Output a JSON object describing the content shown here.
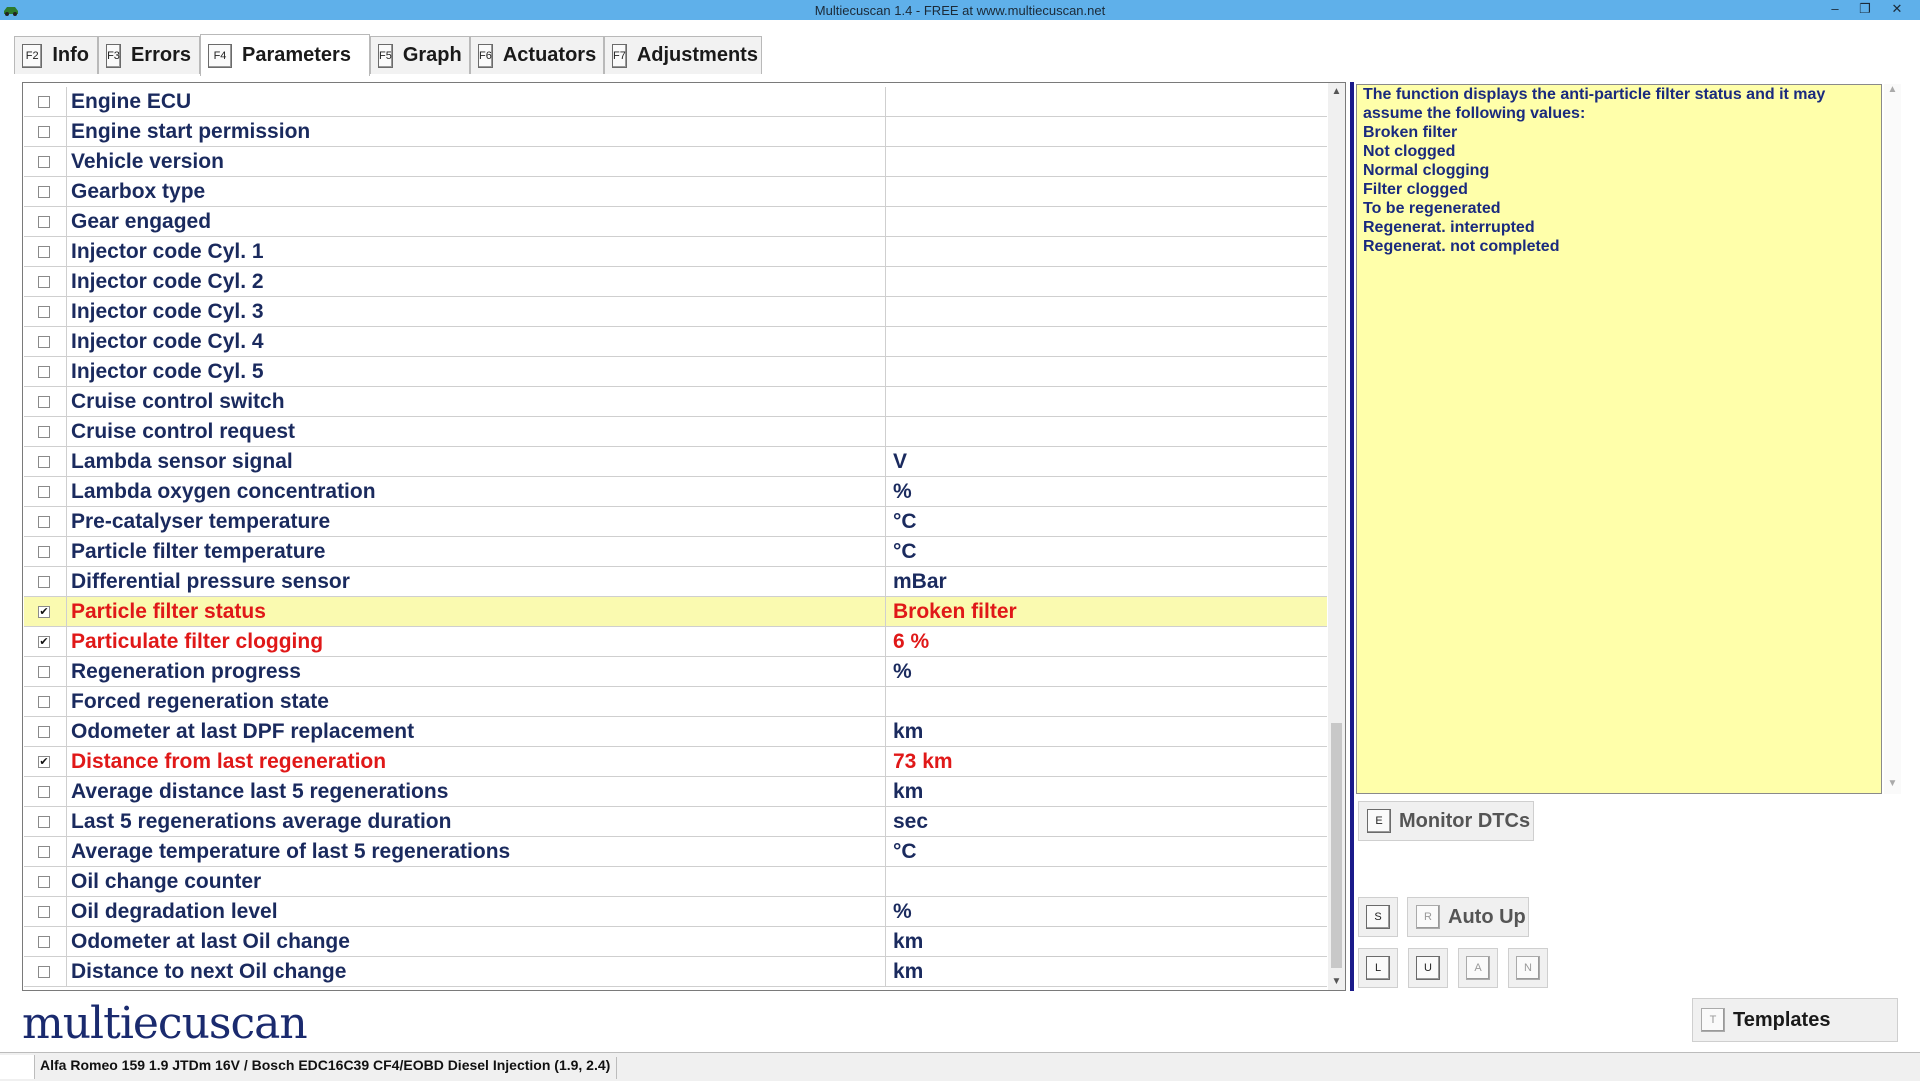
{
  "window": {
    "title": "Multiecuscan 1.4 - FREE at www.multiecuscan.net",
    "minimize": "–",
    "restore": "❐",
    "close": "✕"
  },
  "tabs": [
    {
      "key": "F2",
      "label": "Info",
      "active": false
    },
    {
      "key": "F3",
      "label": "Errors",
      "active": false
    },
    {
      "key": "F4",
      "label": "Parameters",
      "active": true
    },
    {
      "key": "F5",
      "label": "Graph",
      "active": false
    },
    {
      "key": "F6",
      "label": "Actuators",
      "active": false
    },
    {
      "key": "F7",
      "label": "Adjustments",
      "active": false
    }
  ],
  "parameters": [
    {
      "name": "Engine ECU",
      "value": "",
      "checked": false
    },
    {
      "name": "Engine start permission",
      "value": "",
      "checked": false
    },
    {
      "name": "Vehicle version",
      "value": "",
      "checked": false
    },
    {
      "name": "Gearbox type",
      "value": "",
      "checked": false
    },
    {
      "name": "Gear engaged",
      "value": "",
      "checked": false
    },
    {
      "name": "Injector code Cyl. 1",
      "value": "",
      "checked": false
    },
    {
      "name": "Injector code Cyl. 2",
      "value": "",
      "checked": false
    },
    {
      "name": "Injector code Cyl. 3",
      "value": "",
      "checked": false
    },
    {
      "name": "Injector code Cyl. 4",
      "value": "",
      "checked": false
    },
    {
      "name": "Injector code Cyl. 5",
      "value": "",
      "checked": false
    },
    {
      "name": "Cruise control switch",
      "value": "",
      "checked": false
    },
    {
      "name": "Cruise control request",
      "value": "",
      "checked": false
    },
    {
      "name": "Lambda sensor signal",
      "value": "V",
      "checked": false
    },
    {
      "name": "Lambda oxygen concentration",
      "value": "%",
      "checked": false
    },
    {
      "name": "Pre-catalyser temperature",
      "value": "°C",
      "checked": false
    },
    {
      "name": "Particle filter temperature",
      "value": "°C",
      "checked": false
    },
    {
      "name": "Differential pressure sensor",
      "value": "mBar",
      "checked": false
    },
    {
      "name": "Particle filter status",
      "value": "Broken filter",
      "checked": true,
      "selected": true
    },
    {
      "name": "Particulate filter clogging",
      "value": "6 %",
      "checked": true
    },
    {
      "name": "Regeneration progress",
      "value": "%",
      "checked": false
    },
    {
      "name": "Forced regeneration state",
      "value": "",
      "checked": false
    },
    {
      "name": "Odometer at last DPF replacement",
      "value": "km",
      "checked": false
    },
    {
      "name": "Distance from last regeneration",
      "value": "73 km",
      "checked": true
    },
    {
      "name": "Average distance last 5 regenerations",
      "value": "km",
      "checked": false
    },
    {
      "name": "Last 5 regenerations average duration",
      "value": "sec",
      "checked": false
    },
    {
      "name": "Average temperature of last 5 regenerations",
      "value": "°C",
      "checked": false
    },
    {
      "name": "Oil change counter",
      "value": "",
      "checked": false
    },
    {
      "name": "Oil degradation level",
      "value": "%",
      "checked": false
    },
    {
      "name": "Odometer at last Oil change",
      "value": "km",
      "checked": false
    },
    {
      "name": "Distance to next Oil change",
      "value": "km",
      "checked": false
    }
  ],
  "description": {
    "lines": [
      "The function displays the anti-particle filter status and it may",
      "assume the following values:",
      "Broken filter",
      "Not clogged",
      "Normal clogging",
      "Filter clogged",
      "To be regenerated",
      "Regenerat. interrupted",
      "Regenerat. not completed"
    ]
  },
  "buttons": {
    "monitor_dtcs": {
      "key": "E",
      "label": "Monitor DTCs"
    },
    "s": {
      "key": "S"
    },
    "auto_up": {
      "key": "R",
      "label": "Auto Up"
    },
    "l": {
      "key": "L"
    },
    "u": {
      "key": "U"
    },
    "a": {
      "key": "A"
    },
    "n": {
      "key": "N"
    },
    "templates": {
      "key": "T",
      "label": "Templates"
    }
  },
  "logo": {
    "text": "multiecuscan"
  },
  "status": {
    "vehicle": "Alfa Romeo 159 1.9 JTDm 16V / Bosch EDC16C39 CF4/EOBD Diesel Injection (1.9, 2.4)"
  },
  "colors": {
    "titlebar": "#5fb0ea",
    "selected_row": "#fafab0",
    "active_text": "#e01818",
    "desc_bg": "#ffffaa"
  }
}
